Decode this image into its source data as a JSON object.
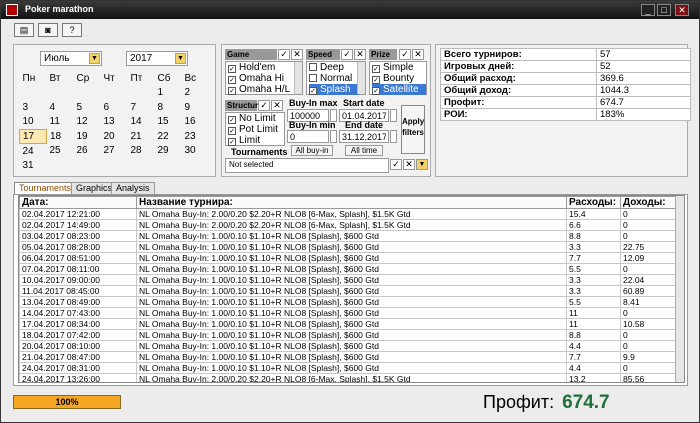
{
  "window": {
    "title": "Poker marathon"
  },
  "toolbar": {
    "db_icon": "database-icon",
    "photo_icon": "camera-icon",
    "help_icon": "help-icon"
  },
  "calendar": {
    "month": "Июль",
    "year": "2017",
    "weekdays": [
      "Пн",
      "Вт",
      "Ср",
      "Чт",
      "Пт",
      "Сб",
      "Вс"
    ],
    "weeks": [
      [
        "",
        "",
        "",
        "",
        "",
        "1",
        "2"
      ],
      [
        "3",
        "4",
        "5",
        "6",
        "7",
        "8",
        "9"
      ],
      [
        "10",
        "11",
        "12",
        "13",
        "14",
        "15",
        "16"
      ],
      [
        "17",
        "18",
        "19",
        "20",
        "21",
        "22",
        "23"
      ],
      [
        "24",
        "25",
        "26",
        "27",
        "28",
        "29",
        "30"
      ],
      [
        "31",
        "",
        "",
        "",
        "",
        "",
        ""
      ]
    ],
    "today": "17"
  },
  "filters": {
    "game": {
      "label": "Game",
      "options": [
        "Hold'em",
        "Omaha Hi",
        "Omaha H/L"
      ]
    },
    "speed": {
      "label": "Speed",
      "options": [
        "Deep",
        "Normal",
        "Splash"
      ]
    },
    "prize": {
      "label": "Prize",
      "options": [
        "Simple",
        "Bounty",
        "Satellite"
      ]
    },
    "structure": {
      "label": "Structure",
      "options": [
        "No Limit",
        "Pot Limit",
        "Limit"
      ]
    },
    "buyin_max_label": "Buy-In max",
    "buyin_max": "100000",
    "buyin_min_label": "Buy-In min",
    "buyin_min": "0",
    "all_buyin": "All buy-in",
    "start_date_label": "Start date",
    "start_date": "01.04.2017",
    "end_date_label": "End date",
    "end_date": "31.12.2017",
    "all_time": "All time",
    "apply": "Apply filters",
    "tournaments_label": "Tournaments",
    "tournaments_value": "Not selected"
  },
  "stats": [
    {
      "k": "Всего турниров:",
      "v": "57"
    },
    {
      "k": "Игровых дней:",
      "v": "52"
    },
    {
      "k": "Общий расход:",
      "v": "369.6"
    },
    {
      "k": "Общий доход:",
      "v": "1044.3"
    },
    {
      "k": "Профит:",
      "v": "674.7"
    },
    {
      "k": "РОИ:",
      "v": "183%"
    }
  ],
  "tabs": [
    "Tournaments",
    "Graphics",
    "Analysis"
  ],
  "grid": {
    "headers": [
      "Дата:",
      "Название турнира:",
      "Расходы:",
      "Доходы:"
    ],
    "rows": [
      [
        "02.04.2017 12:21:00",
        "NL Omaha Buy-In: 2.00/0.20 $2.20+R NLO8 [6-Max, Splash], $1.5K Gtd",
        "15.4",
        "0"
      ],
      [
        "02.04.2017 14:49:00",
        "NL Omaha Buy-In: 2.00/0.20 $2.20+R NLO8 [6-Max, Splash], $1.5K Gtd",
        "6.6",
        "0"
      ],
      [
        "03.04.2017 08:23:00",
        "NL Omaha Buy-In: 1.00/0.10 $1.10+R NLO8 [Splash], $600 Gtd",
        "8.8",
        "0"
      ],
      [
        "05.04.2017 08:28:00",
        "NL Omaha Buy-In: 1.00/0.10 $1.10+R NLO8 [Splash], $600 Gtd",
        "3.3",
        "22.75"
      ],
      [
        "06.04.2017 08:51:00",
        "NL Omaha Buy-In: 1.00/0.10 $1.10+R NLO8 [Splash], $600 Gtd",
        "7.7",
        "12.09"
      ],
      [
        "07.04.2017 08:11:00",
        "NL Omaha Buy-In: 1.00/0.10 $1.10+R NLO8 [Splash], $600 Gtd",
        "5.5",
        "0"
      ],
      [
        "10.04.2017 09:00:00",
        "NL Omaha Buy-In: 1.00/0.10 $1.10+R NLO8 [Splash], $600 Gtd",
        "3.3",
        "22.04"
      ],
      [
        "11.04.2017 08:45:00",
        "NL Omaha Buy-In: 1.00/0.10 $1.10+R NLO8 [Splash], $600 Gtd",
        "3.3",
        "60.89"
      ],
      [
        "13.04.2017 08:49:00",
        "NL Omaha Buy-In: 1.00/0.10 $1.10+R NLO8 [Splash], $600 Gtd",
        "5.5",
        "8.41"
      ],
      [
        "14.04.2017 07:43:00",
        "NL Omaha Buy-In: 1.00/0.10 $1.10+R NLO8 [Splash], $600 Gtd",
        "11",
        "0"
      ],
      [
        "17.04.2017 08:34:00",
        "NL Omaha Buy-In: 1.00/0.10 $1.10+R NLO8 [Splash], $600 Gtd",
        "11",
        "10.58"
      ],
      [
        "18.04.2017 07:42:00",
        "NL Omaha Buy-In: 1.00/0.10 $1.10+R NLO8 [Splash], $600 Gtd",
        "8.8",
        "0"
      ],
      [
        "20.04.2017 08:10:00",
        "NL Omaha Buy-In: 1.00/0.10 $1.10+R NLO8 [Splash], $600 Gtd",
        "4.4",
        "0"
      ],
      [
        "21.04.2017 08:47:00",
        "NL Omaha Buy-In: 1.00/0.10 $1.10+R NLO8 [Splash], $600 Gtd",
        "7.7",
        "9.9"
      ],
      [
        "24.04.2017 08:31:00",
        "NL Omaha Buy-In: 1.00/0.10 $1.10+R NLO8 [Splash], $600 Gtd",
        "4.4",
        "0"
      ],
      [
        "24.04.2017 13:26:00",
        "NL Omaha Buy-In: 2.00/0.20 $2.20+R NLO8 [6-Max, Splash], $1.5K Gtd",
        "13.2",
        "85.56"
      ]
    ]
  },
  "progress": {
    "label": "100%",
    "value": 1.0
  },
  "footer": {
    "profit_label": "Профит:",
    "profit_value": "674.7"
  },
  "colors": {
    "accent": "#3b78d4",
    "progress": "#f5a623",
    "profit": "#1f6f3a"
  }
}
